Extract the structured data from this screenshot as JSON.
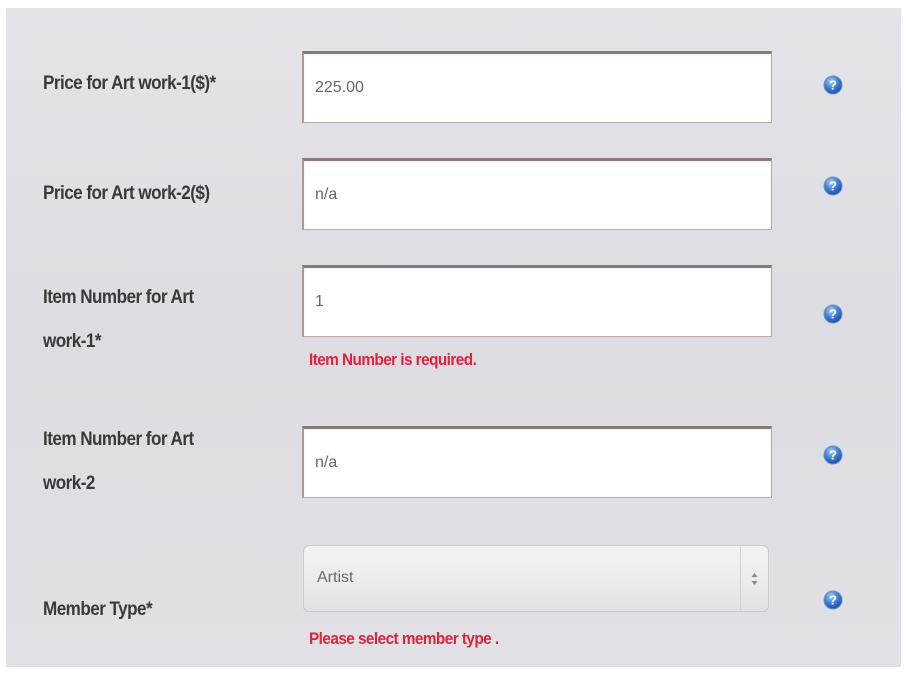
{
  "form": {
    "rows": [
      {
        "label": "Price for Art work-1($)*",
        "value": "225.00",
        "help_icon": "question-help-icon"
      },
      {
        "label": "Price for Art work-2($)",
        "value": "n/a",
        "help_icon": "question-help-icon"
      },
      {
        "label_line1": "Item Number for Art",
        "label_line2": "work-1*",
        "value": "1",
        "error": "Item Number is required.",
        "help_icon": "question-help-icon"
      },
      {
        "label_line1": "Item Number for Art",
        "label_line2": "work-2",
        "value": "n/a",
        "help_icon": "question-help-icon"
      },
      {
        "label": "Member Type*",
        "selected": "Artist",
        "error": "Please select member type .",
        "help_icon": "question-help-icon"
      }
    ]
  },
  "colors": {
    "panel_background": "#dedee4",
    "label_text": "#3a3a3a",
    "error_text": "#e0223c",
    "help_icon_blue": "#3f7fd6"
  }
}
